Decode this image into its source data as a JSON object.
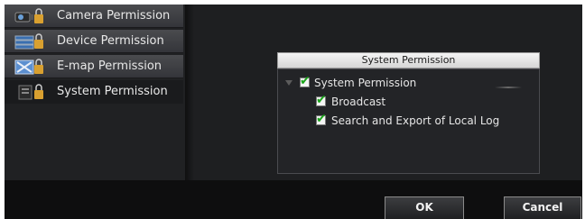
{
  "sidebar": {
    "items": [
      {
        "label": "Camera Permission",
        "icon": "camera-lock-icon"
      },
      {
        "label": "Device Permission",
        "icon": "device-lock-icon"
      },
      {
        "label": "E-map Permission",
        "icon": "emap-lock-icon"
      },
      {
        "label": "System Permission",
        "icon": "system-lock-icon"
      }
    ]
  },
  "panel": {
    "header": "System Permission",
    "tree": {
      "root": {
        "label": "System Permission",
        "checked": true
      },
      "children": [
        {
          "label": "Broadcast",
          "checked": true
        },
        {
          "label": "Search and Export of Local Log",
          "checked": true
        }
      ]
    }
  },
  "footer": {
    "ok_label": "OK",
    "cancel_label": "Cancel"
  },
  "colors": {
    "background": "#1e1f21",
    "nav_item": "#3f4044",
    "check": "#1aa51a"
  }
}
